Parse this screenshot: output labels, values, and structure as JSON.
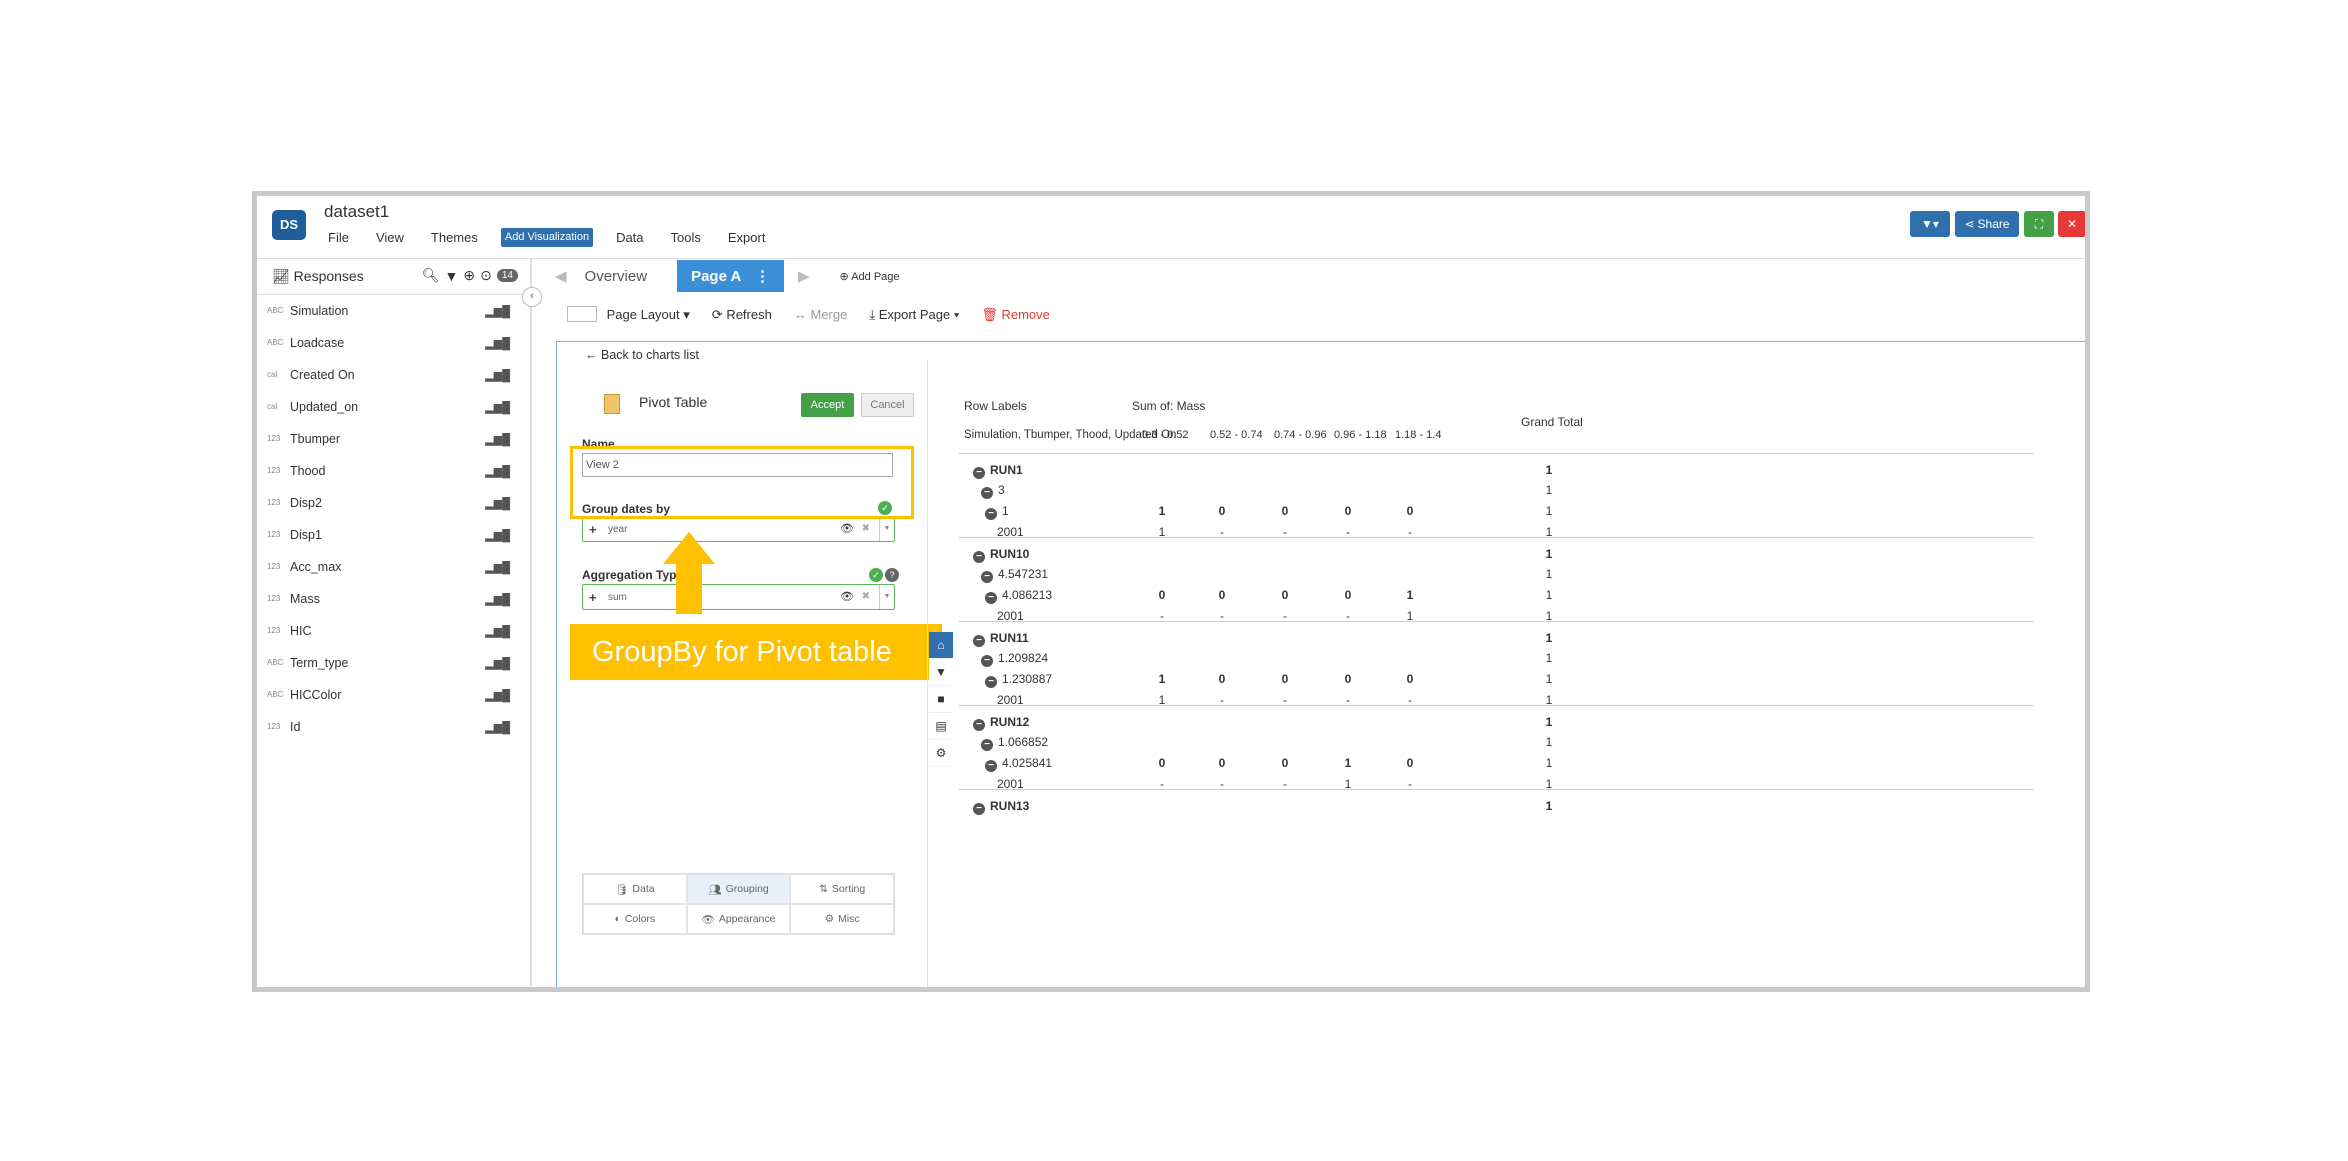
{
  "app": {
    "logo": "DS",
    "title": "dataset1",
    "menu": [
      "File",
      "View",
      "Themes",
      "Add Visualization",
      "Data",
      "Tools",
      "Export"
    ],
    "share_label": "Share"
  },
  "responses": {
    "title": "Responses",
    "count": "14",
    "items": [
      {
        "type": "ABC",
        "name": "Simulation"
      },
      {
        "type": "ABC",
        "name": "Loadcase"
      },
      {
        "type": "cal",
        "name": "Created On"
      },
      {
        "type": "cal",
        "name": "Updated_on"
      },
      {
        "type": "123",
        "name": "Tbumper"
      },
      {
        "type": "123",
        "name": "Thood"
      },
      {
        "type": "123",
        "name": "Disp2"
      },
      {
        "type": "123",
        "name": "Disp1"
      },
      {
        "type": "123",
        "name": "Acc_max"
      },
      {
        "type": "123",
        "name": "Mass"
      },
      {
        "type": "123",
        "name": "HIC"
      },
      {
        "type": "ABC",
        "name": "Term_type"
      },
      {
        "type": "ABC",
        "name": "HICColor"
      },
      {
        "type": "123",
        "name": "Id"
      }
    ]
  },
  "pages": {
    "tabs": [
      "Overview",
      "Page A"
    ],
    "add_page": "Add Page"
  },
  "toolbar": {
    "page_layout": "Page Layout",
    "refresh": "Refresh",
    "merge": "Merge",
    "export_page": "Export Page",
    "remove": "Remove"
  },
  "editor": {
    "back": "Back to charts list",
    "chart_type": "Pivot Table",
    "accept": "Accept",
    "cancel": "Cancel",
    "name_label": "Name",
    "name_value": "View 2",
    "group_dates_label": "Group dates by",
    "group_dates_value": "year",
    "aggregation_label": "Aggregation Type",
    "aggregation_value": "sum",
    "tabs": [
      {
        "icon": "database-icon",
        "label": "Data"
      },
      {
        "icon": "users-icon",
        "label": "Grouping"
      },
      {
        "icon": "sort-icon",
        "label": "Sorting"
      },
      {
        "icon": "colors-icon",
        "label": "Colors"
      },
      {
        "icon": "eye-icon",
        "label": "Appearance"
      },
      {
        "icon": "gear-icon",
        "label": "Misc"
      }
    ]
  },
  "annotation": {
    "callout": "GroupBy for Pivot table",
    "color": "#ffc000"
  },
  "pivot": {
    "row_labels": "Row Labels",
    "value_header": "Sum of: Mass",
    "row_fields": "Simulation, Tbumper, Thood, Updated On",
    "columns": [
      "0.3 - 0.52",
      "0.52 - 0.74",
      "0.74 - 0.96",
      "0.96 - 1.18",
      "1.18 - 1.4"
    ],
    "grand_total": "Grand Total",
    "rows": [
      {
        "label": "RUN1",
        "level": 0,
        "cells": [
          "",
          "",
          "",
          "",
          ""
        ],
        "total": "1"
      },
      {
        "label": "3",
        "level": 1,
        "cells": [
          "",
          "",
          "",
          "",
          ""
        ],
        "total": "1"
      },
      {
        "label": "1",
        "level": 2,
        "cells": [
          "1",
          "0",
          "0",
          "0",
          "0"
        ],
        "total": "1"
      },
      {
        "label": "2001",
        "level": 3,
        "cells": [
          "1",
          "-",
          "-",
          "-",
          "-"
        ],
        "total": "1"
      },
      {
        "label": "RUN10",
        "level": 0,
        "cells": [
          "",
          "",
          "",
          "",
          ""
        ],
        "total": "1"
      },
      {
        "label": "4.547231",
        "level": 1,
        "cells": [
          "",
          "",
          "",
          "",
          ""
        ],
        "total": "1"
      },
      {
        "label": "4.086213",
        "level": 2,
        "cells": [
          "0",
          "0",
          "0",
          "0",
          "1"
        ],
        "total": "1"
      },
      {
        "label": "2001",
        "level": 3,
        "cells": [
          "-",
          "-",
          "-",
          "-",
          "1"
        ],
        "total": "1"
      },
      {
        "label": "RUN11",
        "level": 0,
        "cells": [
          "",
          "",
          "",
          "",
          ""
        ],
        "total": "1"
      },
      {
        "label": "1.209824",
        "level": 1,
        "cells": [
          "",
          "",
          "",
          "",
          ""
        ],
        "total": "1"
      },
      {
        "label": "1.230887",
        "level": 2,
        "cells": [
          "1",
          "0",
          "0",
          "0",
          "0"
        ],
        "total": "1"
      },
      {
        "label": "2001",
        "level": 3,
        "cells": [
          "1",
          "-",
          "-",
          "-",
          "-"
        ],
        "total": "1"
      },
      {
        "label": "RUN12",
        "level": 0,
        "cells": [
          "",
          "",
          "",
          "",
          ""
        ],
        "total": "1"
      },
      {
        "label": "1.066852",
        "level": 1,
        "cells": [
          "",
          "",
          "",
          "",
          ""
        ],
        "total": "1"
      },
      {
        "label": "4.025841",
        "level": 2,
        "cells": [
          "0",
          "0",
          "0",
          "1",
          "0"
        ],
        "total": "1"
      },
      {
        "label": "2001",
        "level": 3,
        "cells": [
          "-",
          "-",
          "-",
          "1",
          "-"
        ],
        "total": "1"
      },
      {
        "label": "RUN13",
        "level": 0,
        "cells": [
          "",
          "",
          "",
          "",
          ""
        ],
        "total": "1"
      }
    ]
  }
}
